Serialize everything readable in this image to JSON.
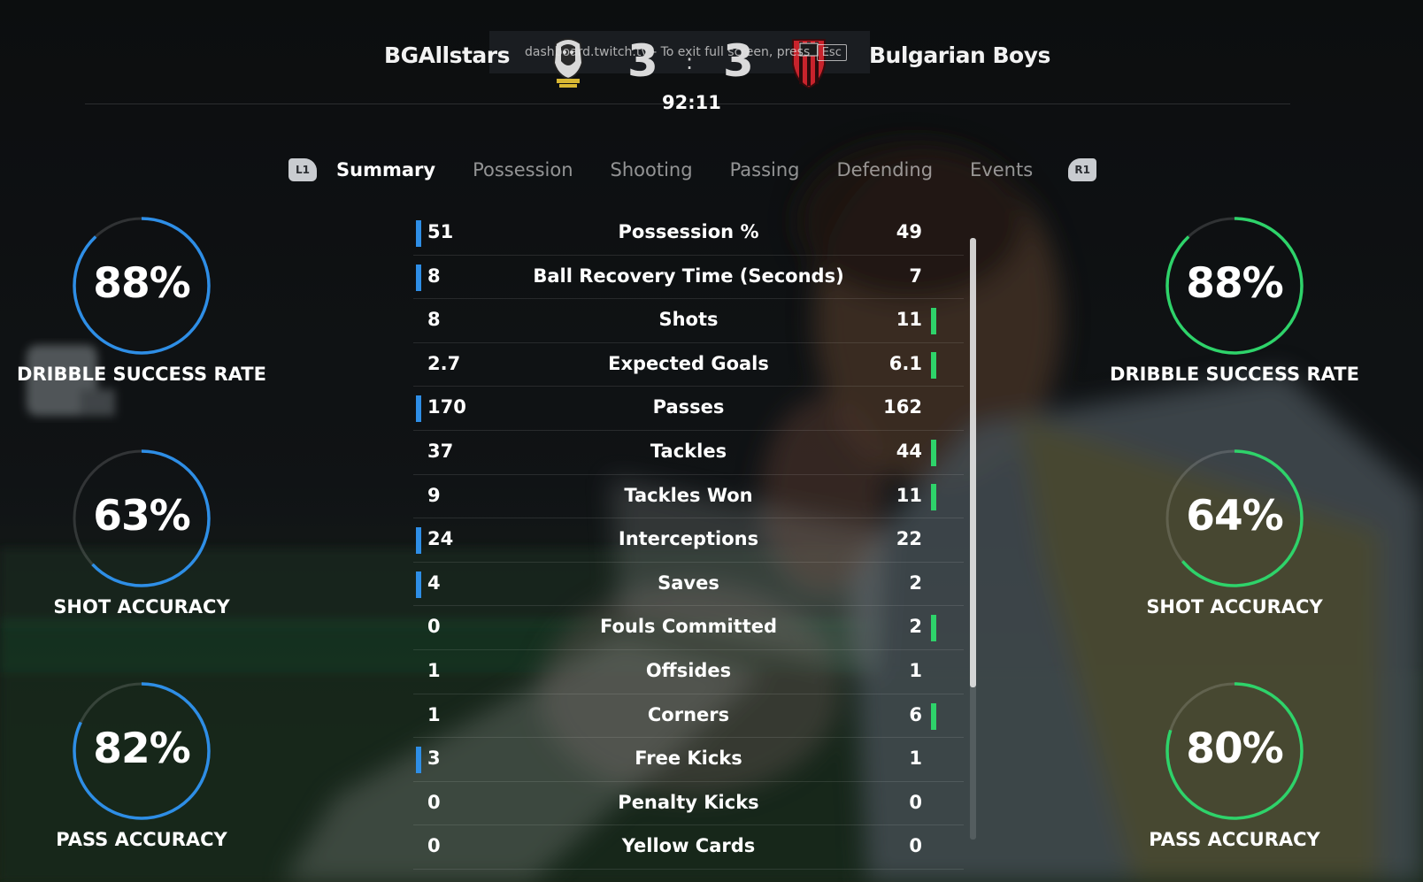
{
  "match": {
    "home_team": "BGAllstars",
    "away_team": "Bulgarian Boys",
    "home_score": "3",
    "away_score": "3",
    "separator": ":",
    "clock": "92:11"
  },
  "overlay": {
    "text": "dashboard.twitch.tv - To exit full screen, press",
    "key": "Esc"
  },
  "tabs": {
    "left_bumper": "L1",
    "right_bumper": "R1",
    "items": [
      "Summary",
      "Possession",
      "Shooting",
      "Passing",
      "Defending",
      "Events"
    ],
    "active": "Summary"
  },
  "stats": [
    {
      "label": "Possession %",
      "home": "51",
      "away": "49",
      "leader": "home"
    },
    {
      "label": "Ball Recovery Time (Seconds)",
      "home": "8",
      "away": "7",
      "leader": "home"
    },
    {
      "label": "Shots",
      "home": "8",
      "away": "11",
      "leader": "away"
    },
    {
      "label": "Expected Goals",
      "home": "2.7",
      "away": "6.1",
      "leader": "away"
    },
    {
      "label": "Passes",
      "home": "170",
      "away": "162",
      "leader": "home"
    },
    {
      "label": "Tackles",
      "home": "37",
      "away": "44",
      "leader": "away"
    },
    {
      "label": "Tackles Won",
      "home": "9",
      "away": "11",
      "leader": "away"
    },
    {
      "label": "Interceptions",
      "home": "24",
      "away": "22",
      "leader": "home"
    },
    {
      "label": "Saves",
      "home": "4",
      "away": "2",
      "leader": "home"
    },
    {
      "label": "Fouls Committed",
      "home": "0",
      "away": "2",
      "leader": "away"
    },
    {
      "label": "Offsides",
      "home": "1",
      "away": "1",
      "leader": "none"
    },
    {
      "label": "Corners",
      "home": "1",
      "away": "6",
      "leader": "away"
    },
    {
      "label": "Free Kicks",
      "home": "3",
      "away": "1",
      "leader": "home"
    },
    {
      "label": "Penalty Kicks",
      "home": "0",
      "away": "0",
      "leader": "none"
    },
    {
      "label": "Yellow Cards",
      "home": "0",
      "away": "0",
      "leader": "none"
    }
  ],
  "rings": {
    "home": [
      {
        "value": "88%",
        "fraction": 0.88,
        "label": "DRIBBLE SUCCESS RATE"
      },
      {
        "value": "63%",
        "fraction": 0.63,
        "label": "SHOT ACCURACY"
      },
      {
        "value": "82%",
        "fraction": 0.82,
        "label": "PASS ACCURACY"
      }
    ],
    "away": [
      {
        "value": "88%",
        "fraction": 0.88,
        "label": "DRIBBLE SUCCESS RATE"
      },
      {
        "value": "64%",
        "fraction": 0.64,
        "label": "SHOT ACCURACY"
      },
      {
        "value": "80%",
        "fraction": 0.8,
        "label": "PASS ACCURACY"
      }
    ]
  },
  "colors": {
    "home_accent": "#2e8ee6",
    "away_accent": "#2ed36a",
    "home_crest": "#d9d9d9",
    "away_crest": "#c8232c"
  },
  "icons": {
    "home_crest": "lion-crest-icon",
    "away_crest": "striped-shield-crest-icon",
    "scrollbar": "scrollbar"
  }
}
